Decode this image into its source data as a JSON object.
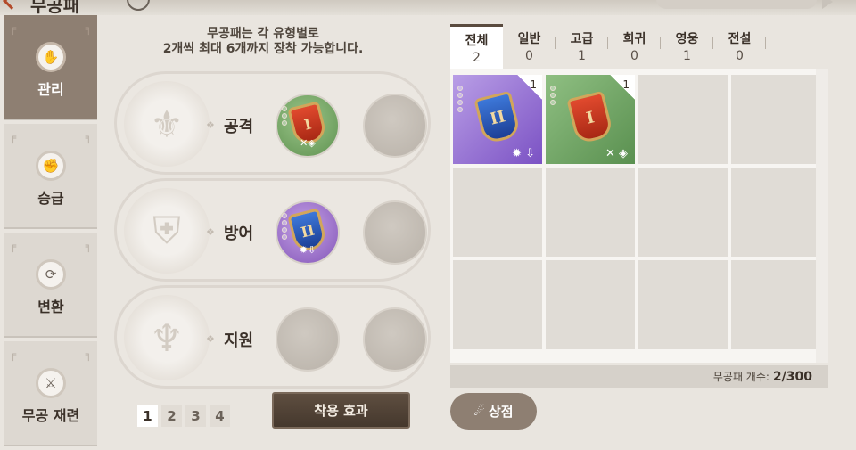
{
  "header": {
    "title_fragment": "무공패"
  },
  "sidebar": {
    "items": [
      {
        "label": "관리",
        "icon": "manage-icon",
        "glyph": "✋"
      },
      {
        "label": "승급",
        "icon": "promote-icon",
        "glyph": "✊"
      },
      {
        "label": "변환",
        "icon": "convert-icon",
        "glyph": "⟳"
      },
      {
        "label": "무공 재련",
        "icon": "refine-icon",
        "glyph": "⚔"
      }
    ]
  },
  "info": {
    "line1": "무공패는 각 유형별로",
    "line2": "2개씩 최대 6개까지 장착 가능합니다."
  },
  "slots": [
    {
      "label": "공격",
      "equipped_numeral": "I",
      "equipped_color": "green"
    },
    {
      "label": "방어",
      "equipped_numeral": "II",
      "equipped_color": "purple"
    },
    {
      "label": "지원"
    }
  ],
  "pagination": {
    "pages": [
      "1",
      "2",
      "3",
      "4"
    ],
    "active": "1"
  },
  "apply_button": "착용 효과",
  "tabs": [
    {
      "label": "전체",
      "count": "2"
    },
    {
      "label": "일반",
      "count": "0"
    },
    {
      "label": "고급",
      "count": "1"
    },
    {
      "label": "희귀",
      "count": "0"
    },
    {
      "label": "영웅",
      "count": "1"
    },
    {
      "label": "전설",
      "count": "0"
    }
  ],
  "inventory": {
    "items": [
      {
        "count": "1",
        "numeral": "II",
        "color": "purple",
        "rarity": "hero"
      },
      {
        "count": "1",
        "numeral": "I",
        "color": "green",
        "rarity": "advanced"
      }
    ],
    "count_label": "무공패 개수:",
    "count_value": "2/300"
  },
  "shop_button": "상점"
}
